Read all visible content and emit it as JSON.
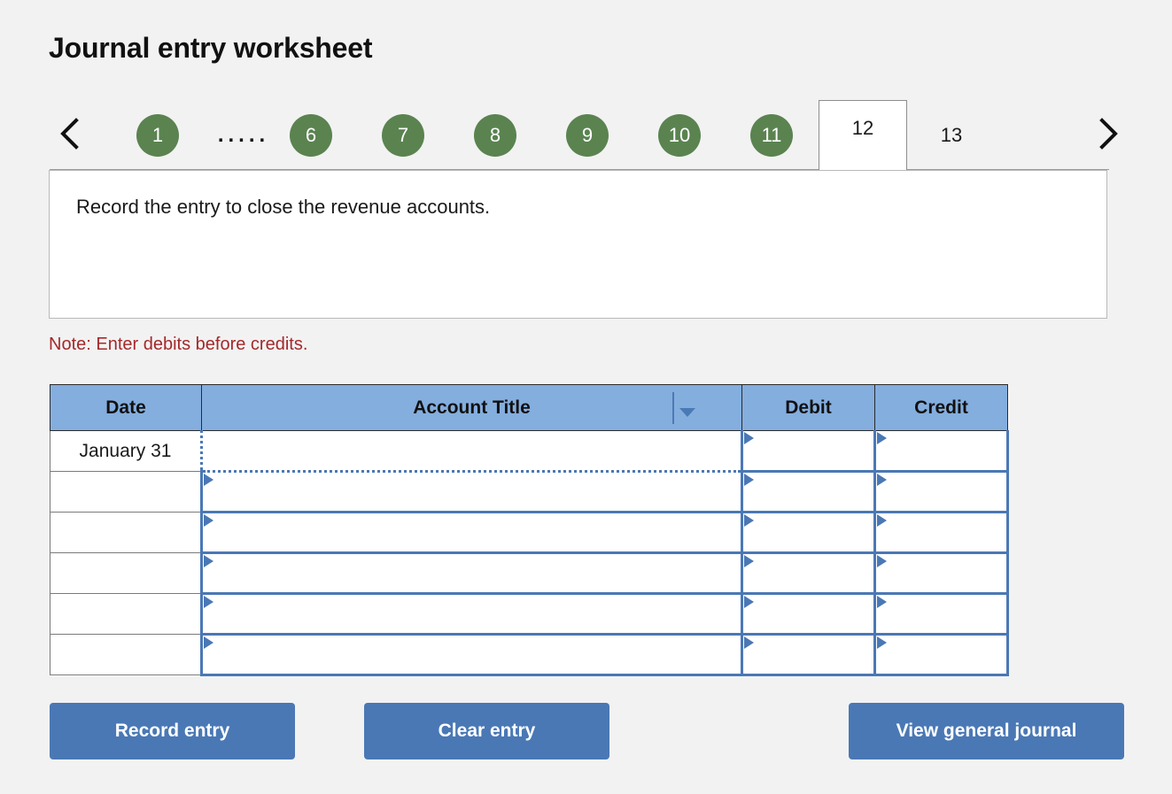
{
  "page": {
    "title": "Journal entry worksheet"
  },
  "tabs": {
    "prev_icon": "chevron-left-icon",
    "next_icon": "chevron-right-icon",
    "ellipsis": ".....",
    "active_index": 12,
    "items": [
      {
        "label": "1",
        "state": "completed"
      },
      {
        "label": "6",
        "state": "completed"
      },
      {
        "label": "7",
        "state": "completed"
      },
      {
        "label": "8",
        "state": "completed"
      },
      {
        "label": "9",
        "state": "completed"
      },
      {
        "label": "10",
        "state": "completed"
      },
      {
        "label": "11",
        "state": "completed"
      },
      {
        "label": "12",
        "state": "active"
      },
      {
        "label": "13",
        "state": "pending"
      }
    ]
  },
  "instruction": {
    "text": "Record the entry to close the revenue accounts."
  },
  "note": {
    "text": "Note: Enter debits before credits.",
    "color": "#a3292b"
  },
  "table": {
    "headers": {
      "date": "Date",
      "account_title": "Account Title",
      "debit": "Debit",
      "credit": "Credit"
    },
    "account_title_dropdown_icon": "chevron-down-icon",
    "rows": [
      {
        "date": "January 31",
        "account_title": "",
        "debit": "",
        "credit": "",
        "selected_cell": "account_title"
      },
      {
        "date": "",
        "account_title": "",
        "debit": "",
        "credit": "",
        "selected_cell": ""
      },
      {
        "date": "",
        "account_title": "",
        "debit": "",
        "credit": "",
        "selected_cell": ""
      },
      {
        "date": "",
        "account_title": "",
        "debit": "",
        "credit": "",
        "selected_cell": ""
      },
      {
        "date": "",
        "account_title": "",
        "debit": "",
        "credit": "",
        "selected_cell": ""
      },
      {
        "date": "",
        "account_title": "",
        "debit": "",
        "credit": "",
        "selected_cell": ""
      }
    ]
  },
  "buttons": {
    "record_entry": "Record entry",
    "clear_entry": "Clear entry",
    "view_general_journal": "View general journal"
  },
  "colors": {
    "badge_green": "#5a8350",
    "header_blue": "#84aede",
    "field_blue": "#4a78b5",
    "button_blue": "#4a78b5",
    "note_red": "#a3292b",
    "page_bg": "#f2f2f2"
  }
}
